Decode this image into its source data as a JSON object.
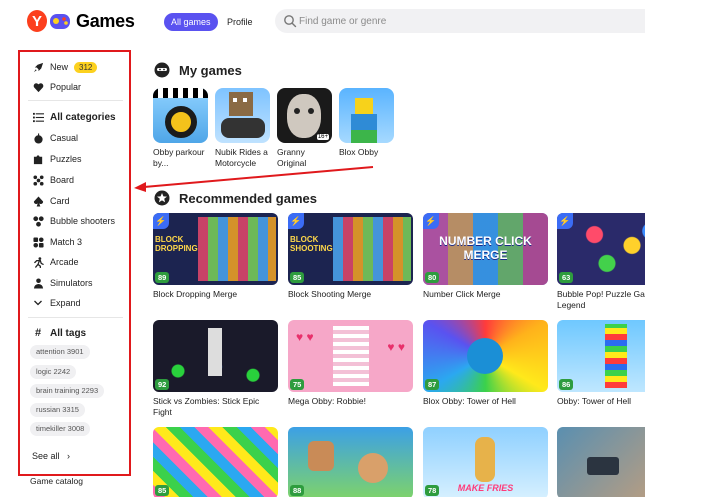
{
  "header": {
    "logo_letter": "Y",
    "logo_text": "Games",
    "tab_all": "All games",
    "tab_profile": "Profile",
    "search_placeholder": "Find game or genre"
  },
  "sidebar": {
    "new_label": "New",
    "new_count": "312",
    "popular_label": "Popular",
    "all_categories": "All categories",
    "categories": [
      "Casual",
      "Puzzles",
      "Board",
      "Card",
      "Bubble shooters",
      "Match 3",
      "Arcade",
      "Simulators"
    ],
    "expand": "Expand",
    "all_tags": "All tags",
    "tags": [
      "attention 3901",
      "logic 2242",
      "brain training 2293",
      "russian 3315",
      "timekiller 3008"
    ],
    "see_all": "See all",
    "catalog": "Game catalog"
  },
  "my_games": {
    "title": "My games",
    "items": [
      {
        "label": "Obby parkour by..."
      },
      {
        "label": "Nubik Rides a Motorcycle"
      },
      {
        "label": "Granny Original"
      },
      {
        "label": "Blox Obby"
      }
    ]
  },
  "recommended": {
    "title": "Recommended games",
    "items": [
      {
        "label": "Block Dropping Merge",
        "rating": "89",
        "thumb_text": "BLOCK DROPPING",
        "color": "#1c2450"
      },
      {
        "label": "Block Shooting Merge",
        "rating": "85",
        "thumb_text": "BLOCK SHOOTING",
        "color": "#1c2450"
      },
      {
        "label": "Number Click Merge",
        "rating": "80",
        "thumb_text": "NUMBER CLICK MERGE",
        "color": "#2b55c9"
      },
      {
        "label": "Bubble Pop! Puzzle Game Legend",
        "rating": "63",
        "thumb_text": "",
        "color": "#2a2a6a"
      },
      {
        "label": "Stick vs Zombies: Stick Epic Fight",
        "rating": "92",
        "thumb_text": "",
        "color": "#1a1a2a"
      },
      {
        "label": "Mega Obby: Robbie!",
        "rating": "75",
        "thumb_text": "",
        "color": "#f6a7c8"
      },
      {
        "label": "Blox Obby: Tower of Hell",
        "rating": "87",
        "thumb_text": "",
        "color": "#2bb1f0"
      },
      {
        "label": "Obby: Tower of Hell",
        "rating": "86",
        "thumb_text": "",
        "color": "#6fc8ff"
      },
      {
        "label": "",
        "rating": "85",
        "thumb_text": "",
        "color": "#ff6ab0"
      },
      {
        "label": "",
        "rating": "88",
        "thumb_text": "",
        "color": "#3ca0e6"
      },
      {
        "label": "",
        "rating": "78",
        "thumb_text": "MAKE FRIES",
        "color": "#8fd0ff"
      },
      {
        "label": "",
        "rating": "",
        "thumb_text": "",
        "color": "#5a8fb0"
      }
    ]
  }
}
